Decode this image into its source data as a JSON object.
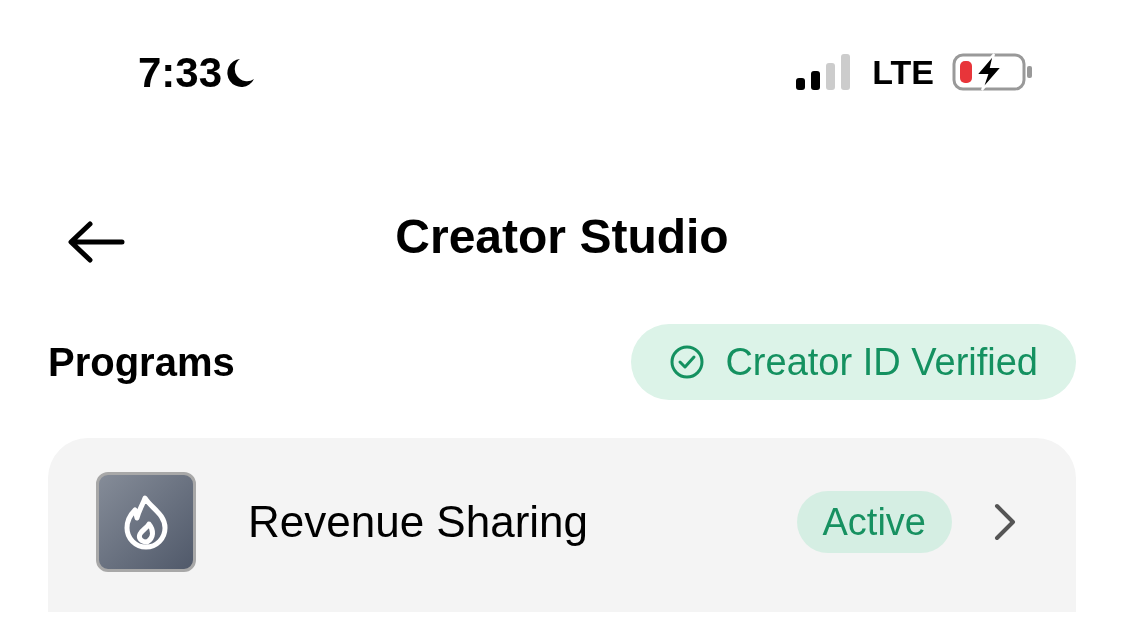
{
  "status_bar": {
    "time": "7:33",
    "network": "LTE"
  },
  "header": {
    "title": "Creator Studio"
  },
  "programs": {
    "title": "Programs",
    "badge": "Creator ID Verified",
    "items": [
      {
        "label": "Revenue Sharing",
        "status": "Active"
      }
    ]
  }
}
